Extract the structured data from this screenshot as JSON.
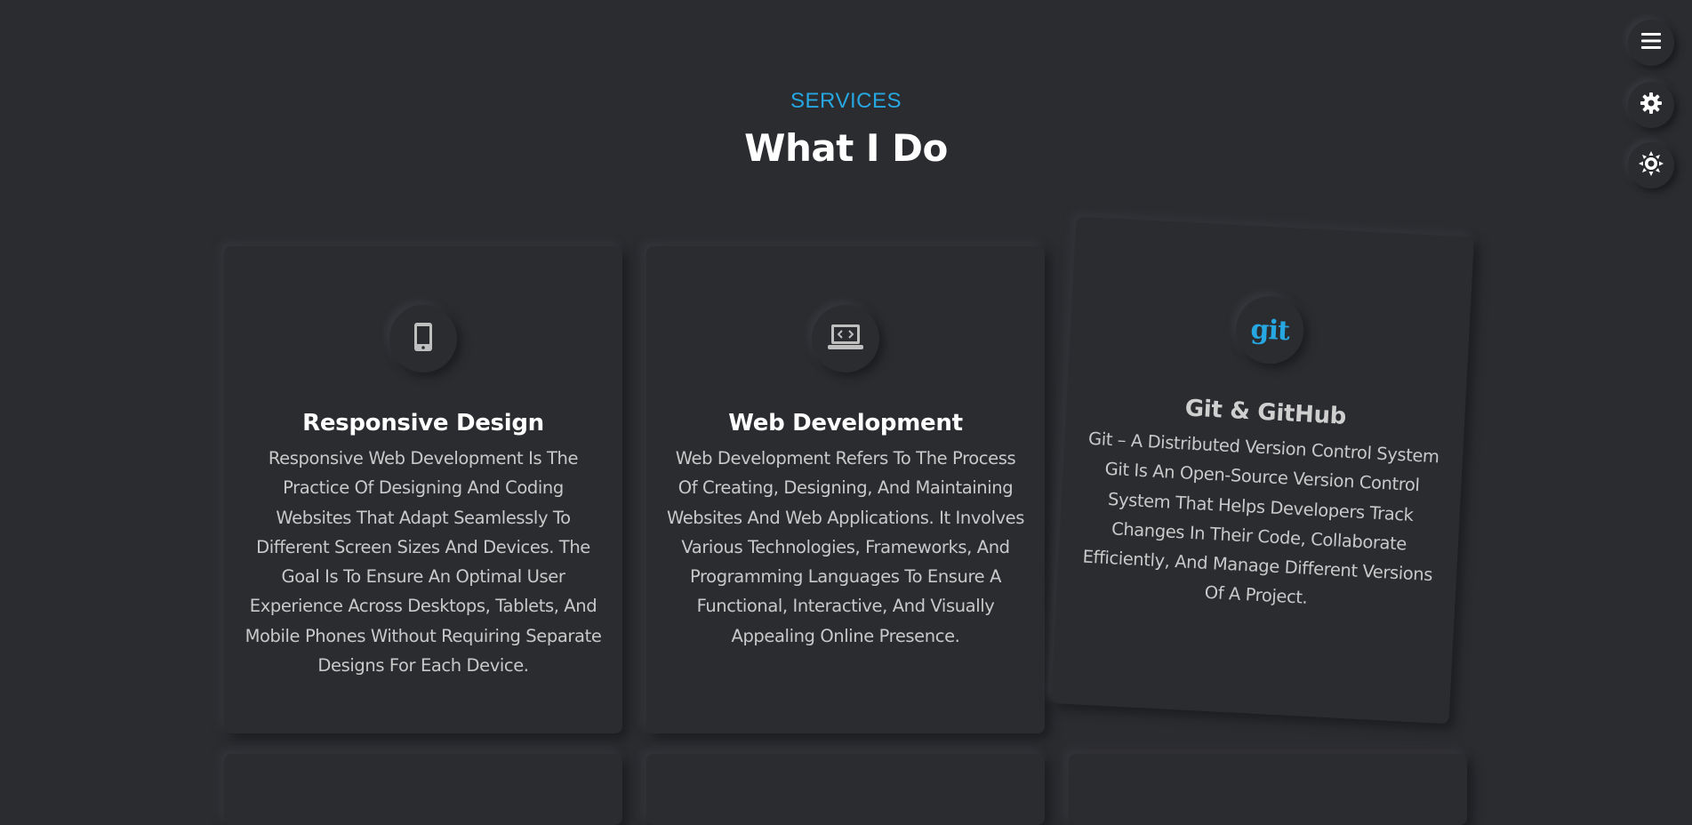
{
  "header": {
    "kicker": "SERVICES",
    "title": "What I Do"
  },
  "services": [
    {
      "icon": "mobile-phone-icon",
      "title": "Responsive Design",
      "description": "Responsive Web Development Is The Practice Of Designing And Coding Websites That Adapt Seamlessly To Different Screen Sizes And Devices. The Goal Is To Ensure An Optimal User Experience Across Desktops, Tablets, And Mobile Phones Without Requiring Separate Designs For Each Device."
    },
    {
      "icon": "laptop-code-icon",
      "title": "Web Development",
      "description": "Web Development Refers To The Process Of Creating, Designing, And Maintaining Websites And Web Applications. It Involves Various Technologies, Frameworks, And Programming Languages To Ensure A Functional, Interactive, And Visually Appealing Online Presence."
    },
    {
      "icon": "git-logo-icon",
      "icon_text": "git",
      "title": "Git & GitHub",
      "description": "Git – A Distributed Version Control System Git Is An Open-Source Version Control System That Helps Developers Track Changes In Their Code, Collaborate Efficiently, And Manage Different Versions Of A Project."
    }
  ],
  "sidebar_buttons": [
    {
      "name": "menu-button",
      "icon": "hamburger-menu-icon"
    },
    {
      "name": "settings-button",
      "icon": "gear-icon"
    },
    {
      "name": "theme-toggle-button",
      "icon": "sun-icon"
    }
  ],
  "colors": {
    "background": "#2b2c30",
    "accent": "#26a7e1",
    "heading": "#ffffff",
    "body_text": "#c9c9c9"
  }
}
